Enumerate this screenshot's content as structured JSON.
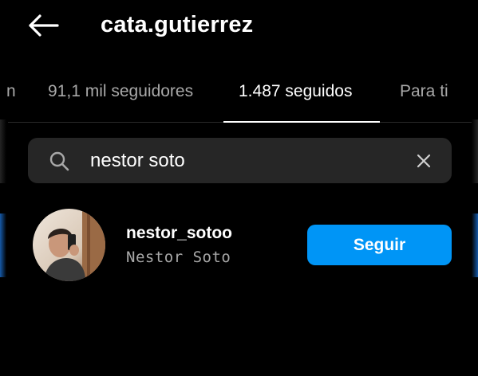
{
  "header": {
    "title": "cata.gutierrez",
    "back_icon": "arrow-left-icon"
  },
  "tabs": [
    {
      "label": "n",
      "active": false
    },
    {
      "label": "91,1 mil seguidores",
      "active": false
    },
    {
      "label": "1.487 seguidos",
      "active": true
    },
    {
      "label": "Para ti",
      "active": false
    }
  ],
  "search": {
    "value": "nestor soto",
    "search_icon": "search-icon",
    "clear_icon": "close-icon"
  },
  "results": [
    {
      "username": "nestor_sotoo",
      "full_name": "Nestor Soto",
      "follow_label": "Seguir"
    }
  ],
  "colors": {
    "background": "#000000",
    "search_bg": "#262626",
    "secondary_text": "#a8a8a8",
    "follow_button": "#0095f6"
  }
}
